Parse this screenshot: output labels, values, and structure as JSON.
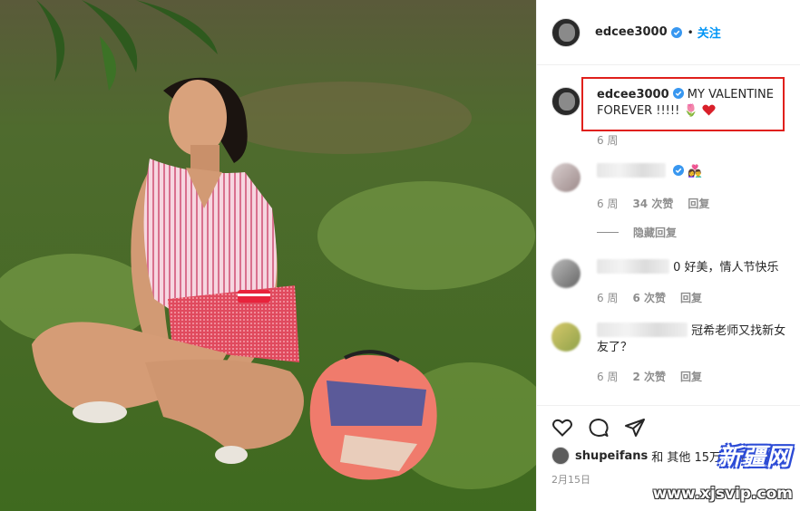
{
  "photo": {
    "alt_icon": "portrait-photo"
  },
  "post": {
    "author": "edcee3000",
    "follow_label": "关注",
    "dot": "•",
    "caption_author": "edcee3000",
    "caption_text": "MY VALENTINE FOREVER !!!!!",
    "caption_time": "6 周"
  },
  "comments": [
    {
      "text": "",
      "time": "6 周",
      "likes": "34 次赞",
      "reply": "回复",
      "hide_replies": "隐藏回复"
    },
    {
      "text": "0 好美，情人节快乐",
      "time": "6 周",
      "likes": "6 次赞",
      "reply": "回复"
    },
    {
      "text": "冠希老师又找新女友了？",
      "time": "6 周",
      "likes": "2 次赞",
      "reply": "回复"
    }
  ],
  "footer": {
    "liked_by_user": "shupeifans",
    "liked_by_rest": "和 其他 15万 位用户 赞了",
    "date": "2月15日"
  },
  "watermark": {
    "text": "新疆网",
    "url": "www.xjsvip.com"
  },
  "colors": {
    "accent": "#0095f6",
    "highlight": "#e0201c",
    "heart": "#d9202a"
  }
}
